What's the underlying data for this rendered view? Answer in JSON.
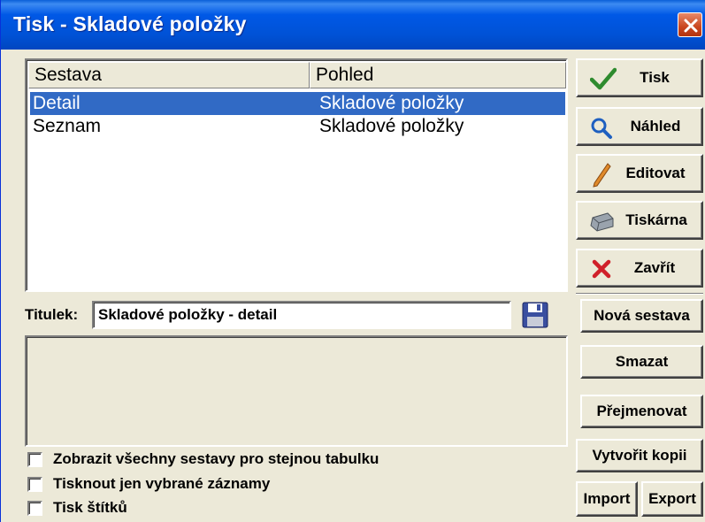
{
  "window": {
    "title": "Tisk - Skladové položky"
  },
  "list": {
    "columns": [
      "Sestava",
      "Pohled"
    ],
    "rows": [
      {
        "sestava": "Detail",
        "pohled": "Skladové položky",
        "selected": true
      },
      {
        "sestava": "Seznam",
        "pohled": "Skladové položky",
        "selected": false
      }
    ]
  },
  "buttons": {
    "tisk": {
      "label": "Tisk",
      "icon": "checkmark-icon"
    },
    "nahled": {
      "label": "Náhled",
      "icon": "magnifier-icon"
    },
    "editovat": {
      "label": "Editovat",
      "icon": "pencil-icon"
    },
    "tiskarna": {
      "label": "Tiskárna",
      "icon": "printer-icon"
    },
    "zavrit": {
      "label": "Zavřít",
      "icon": "red-x-icon"
    },
    "nova_sestava": {
      "label": "Nová sestava"
    },
    "smazat": {
      "label": "Smazat"
    },
    "prejmenovat": {
      "label": "Přejmenovat"
    },
    "vytvorit_kopii": {
      "label": "Vytvořit kopii"
    },
    "import": {
      "label": "Import"
    },
    "export": {
      "label": "Export"
    }
  },
  "titulek": {
    "label": "Titulek:",
    "value": "Skladové položky - detail"
  },
  "checkboxes": [
    {
      "label": "Zobrazit všechny sestavy pro stejnou tabulku",
      "checked": false
    },
    {
      "label": "Tisknout jen vybrané záznamy",
      "checked": false
    },
    {
      "label": "Tisk štítků",
      "checked": false
    }
  ],
  "colors": {
    "titlebar": "#0058e6",
    "selection": "#316ac5",
    "face": "#ece9d8",
    "close": "#c9461f"
  }
}
